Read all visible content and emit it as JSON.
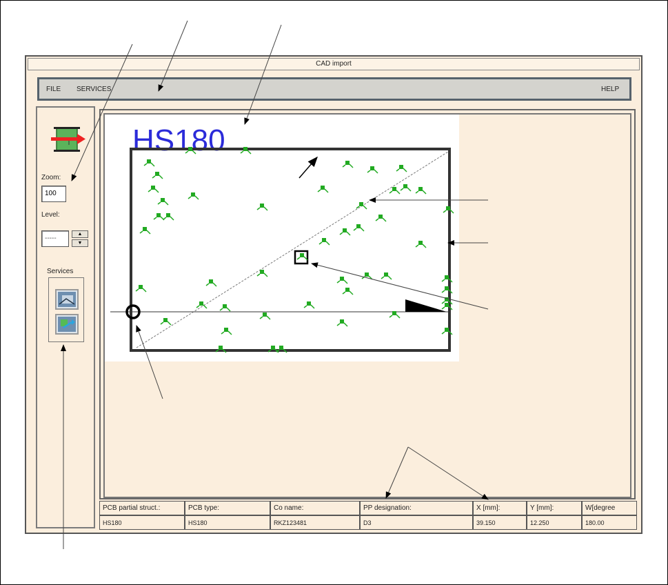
{
  "window": {
    "title": "CAD import"
  },
  "menubar": {
    "items": [
      "FILE",
      "SERVICES"
    ],
    "help": "HELP"
  },
  "sidepanel": {
    "zoom_label": "Zoom:",
    "zoom_value": "100",
    "level_label": "Level:",
    "level_value": "-----",
    "services_label": "Services",
    "icons": [
      "cad-import-icon",
      "service-1-icon",
      "service-2-icon"
    ]
  },
  "board": {
    "name": "HS180",
    "name_color": "#2b2bd9",
    "component_color": "#22aa22"
  },
  "status": {
    "columns": [
      {
        "header": "PCB partial struct.:",
        "value": "HS180"
      },
      {
        "header": "PCB type:",
        "value": "HS180"
      },
      {
        "header": "Co name:",
        "value": "RKZ123481"
      },
      {
        "header": "PP designation:",
        "value": "D3"
      },
      {
        "header": "X [mm]:",
        "value": "39.150"
      },
      {
        "header": "Y [mm]:",
        "value": "12.250"
      },
      {
        "header": "W[degree",
        "value": "180.00"
      }
    ]
  }
}
